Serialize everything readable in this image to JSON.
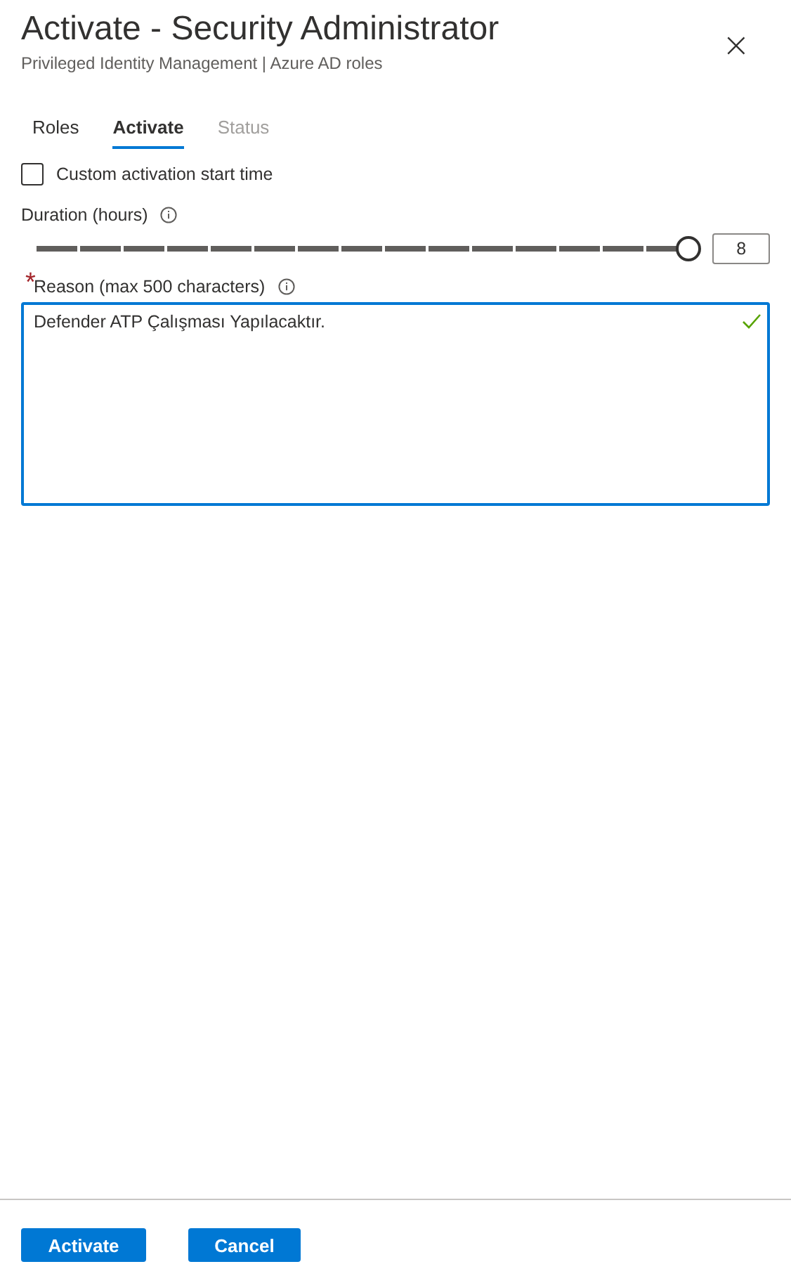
{
  "title": "Activate - Security Administrator",
  "subtitle": "Privileged Identity Management | Azure AD roles",
  "close": "×",
  "tabs": [
    {
      "label": "Roles",
      "selected": false,
      "disabled": false
    },
    {
      "label": "Activate",
      "selected": true,
      "disabled": false
    },
    {
      "label": "Status",
      "selected": false,
      "disabled": true
    }
  ],
  "custom_start": {
    "label": "Custom activation start time",
    "checked": false
  },
  "duration": {
    "label": "Duration (hours)",
    "level": 1,
    "value": "8"
  },
  "reason": {
    "label": "Reason (max 500 characters)",
    "required": true,
    "required_mark": "*",
    "value": "Defender ATP Çalışması Yapılacaktır.",
    "valid": true
  },
  "buttons": [
    {
      "label": "Activate"
    },
    {
      "label": "Cancel"
    }
  ]
}
